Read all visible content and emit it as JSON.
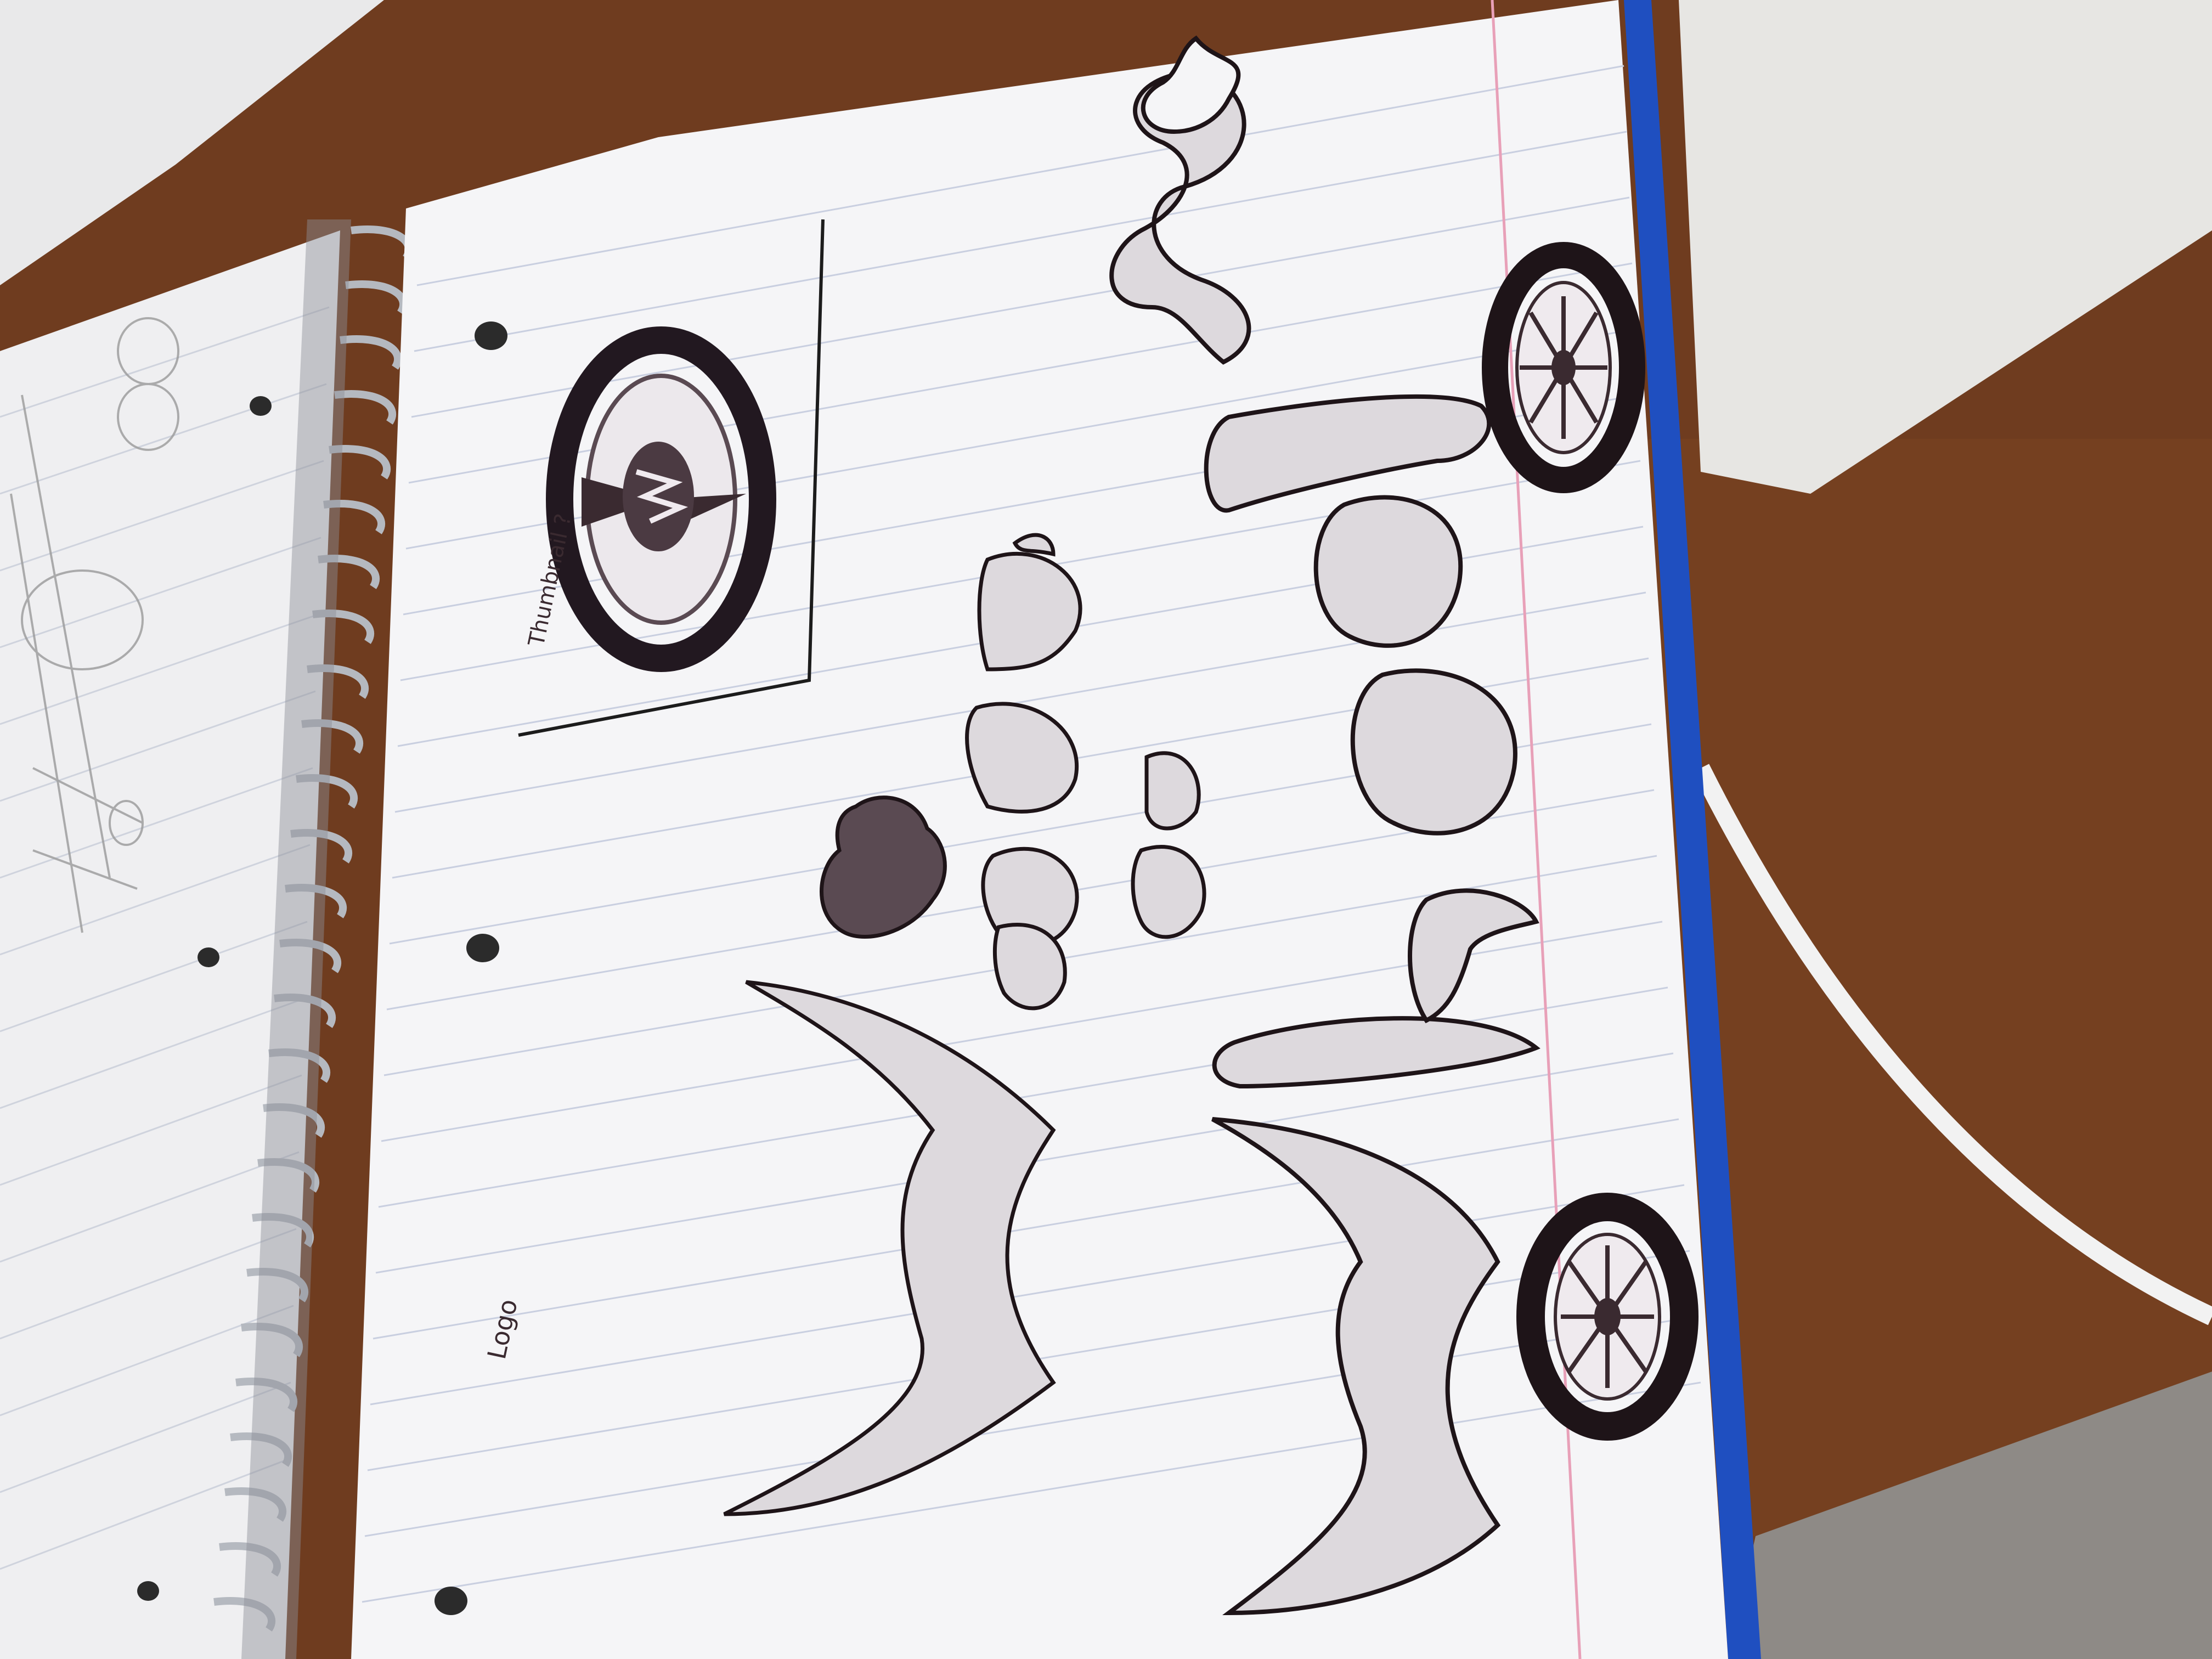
{
  "image": {
    "kind": "photo",
    "subject": "open spiral notebook with logo sketches"
  },
  "annotations": {
    "thumbnail_label": "Thumbnail ?",
    "logo_label": "Logo"
  },
  "icons": {
    "thumbnail_emblem": "wheel-w-emblem-icon",
    "wheel_top": "wheel-icon",
    "wheel_bottom": "wheel-icon",
    "heart": "heart-icon",
    "small_heart": "heart-icon"
  },
  "colors": {
    "desk": "#6b3a1e",
    "paper": "#f4f4f6",
    "ink": "#2b1d24",
    "rule_line": "#c9cfe0",
    "margin_line": "#e8a0b8",
    "notebook_cover": "#1f4fc0",
    "monitor": "#e6e6e4",
    "spiral": "#b9bcc2"
  }
}
